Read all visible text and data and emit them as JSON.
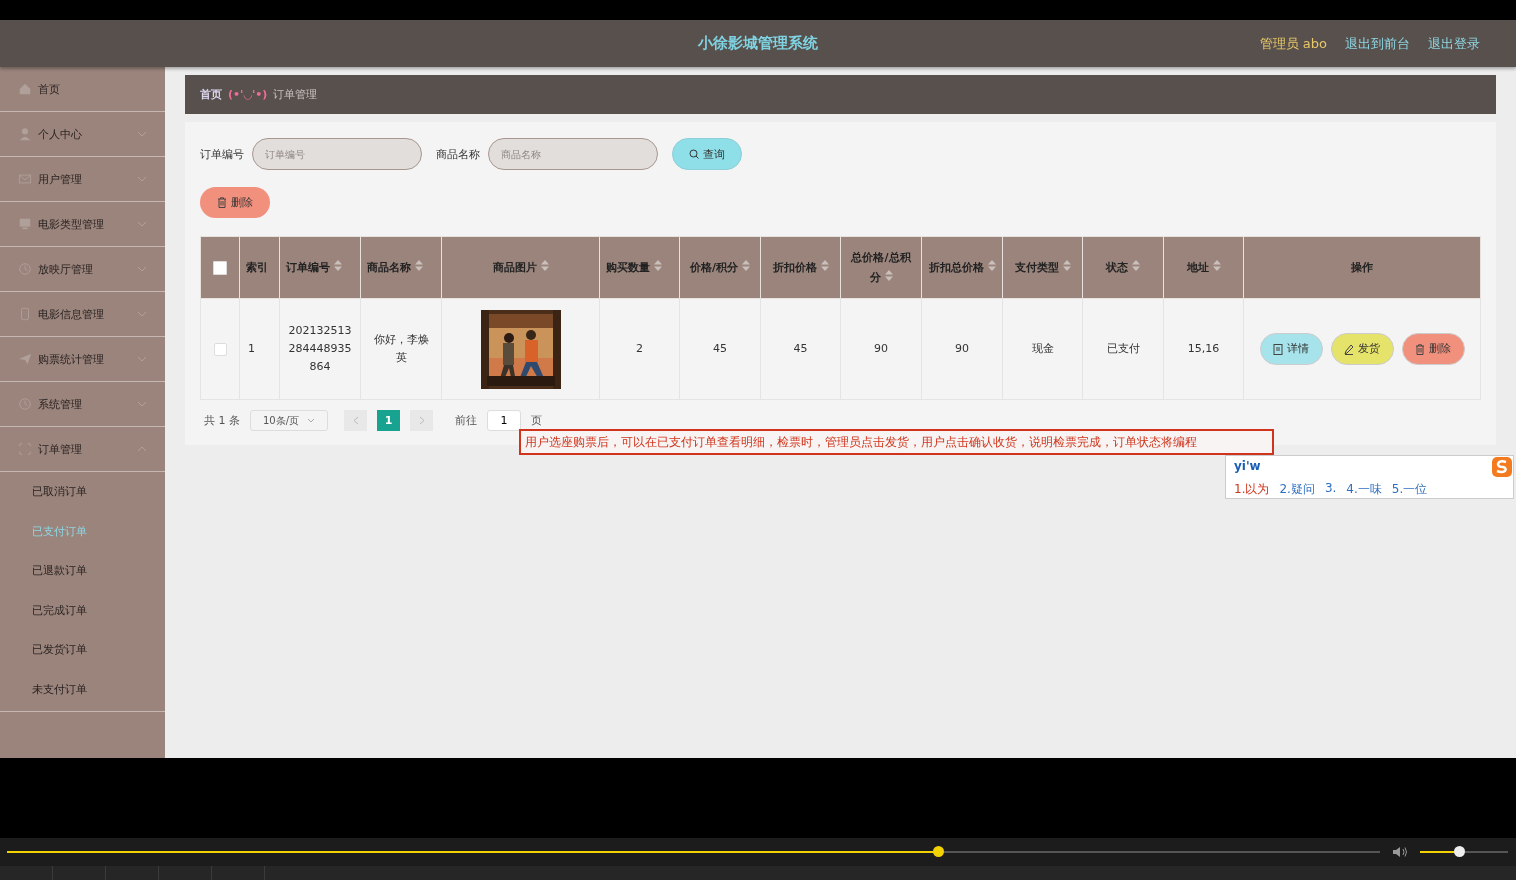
{
  "app": {
    "title": "小徐影城管理系统",
    "user": "管理员 abo",
    "header_links": [
      "退出到前台",
      "退出登录"
    ],
    "sidebar": {
      "items": [
        {
          "label": "首页"
        },
        {
          "label": "个人中心",
          "expanded": false
        },
        {
          "label": "用户管理",
          "expanded": false
        },
        {
          "label": "电影类型管理",
          "expanded": false
        },
        {
          "label": "放映厅管理",
          "expanded": false
        },
        {
          "label": "电影信息管理",
          "expanded": false
        },
        {
          "label": "购票统计管理",
          "expanded": false
        },
        {
          "label": "系统管理",
          "expanded": false
        },
        {
          "label": "订单管理",
          "expanded": true,
          "children": [
            {
              "label": "已取消订单",
              "selected": false
            },
            {
              "label": "已支付订单",
              "selected": true
            },
            {
              "label": "已退款订单",
              "selected": false
            },
            {
              "label": "已完成订单",
              "selected": false
            },
            {
              "label": "已发货订单",
              "selected": false
            },
            {
              "label": "未支付订单",
              "selected": false
            }
          ]
        }
      ]
    },
    "breadcrumb": {
      "home": "首页",
      "separator": "(•'◡'•)",
      "current": "订单管理"
    },
    "search": [
      {
        "label": "订单编号",
        "placeholder": "订单编号"
      },
      {
        "label": "商品名称",
        "placeholder": "商品名称"
      }
    ],
    "query_button": "查询",
    "delete_button": "删除",
    "table": {
      "select_all_checked": false,
      "columns": [
        {
          "label": "索引",
          "sortable": false
        },
        {
          "label": "订单编号",
          "sortable": true
        },
        {
          "label": "商品名称",
          "sortable": true
        },
        {
          "label": "商品图片",
          "sortable": true
        },
        {
          "label": "购买数量",
          "sortable": true
        },
        {
          "label": "价格/积分",
          "sortable": true
        },
        {
          "label": "折扣价格",
          "sortable": true
        },
        {
          "label": "总价格/总积分",
          "sortable": true
        },
        {
          "label": "折扣总价格",
          "sortable": true
        },
        {
          "label": "支付类型",
          "sortable": true
        },
        {
          "label": "状态",
          "sortable": true
        },
        {
          "label": "地址",
          "sortable": true
        },
        {
          "label": "操作",
          "sortable": false
        }
      ],
      "rows": [
        {
          "checked": false,
          "cells": [
            "1",
            "202132513284448935864",
            "你好，李焕英",
            {
              "kind": "picture"
            },
            "2",
            "45",
            "45",
            "90",
            "90",
            "现金",
            "已支付",
            "15,16"
          ],
          "actions": [
            {
              "kind": "detail",
              "label": "详情"
            },
            {
              "kind": "ship",
              "label": "发货"
            },
            {
              "kind": "delete",
              "label": "删除"
            }
          ]
        }
      ]
    },
    "pagination": {
      "total": "共 1 条",
      "page_size": "10条/页",
      "pages": [
        {
          "label": "1",
          "selected": true
        }
      ],
      "goto_label": "前往",
      "goto_value": "1",
      "goto_suffix": "页"
    },
    "annotation": "用户选座购票后，可以在已支付订单查看明细，检票时，管理员点击发货，用户点击确认收货，说明检票完成，订单状态将编程",
    "ime": {
      "input": "yi'w",
      "candidates": [
        {
          "label": "1.以为",
          "selected": true
        },
        {
          "label": "2.疑问",
          "selected": false
        },
        {
          "label": "3.",
          "selected": false
        },
        {
          "label": "4.一味",
          "selected": false
        },
        {
          "label": "5.一位",
          "selected": false
        }
      ]
    }
  },
  "player": {
    "progress": {
      "level": 0.678
    },
    "volume": {
      "level": 0.44
    }
  }
}
